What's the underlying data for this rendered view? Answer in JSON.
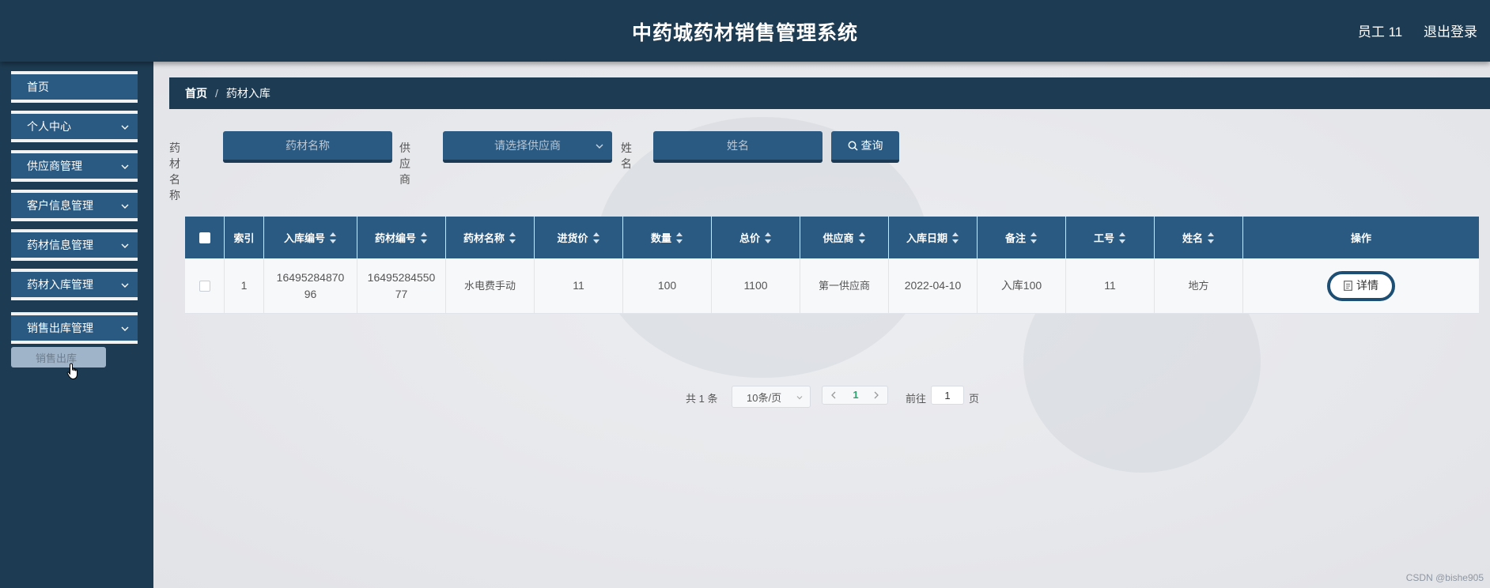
{
  "header": {
    "title": "中药城药材销售管理系统",
    "user": "员工 11",
    "logout": "退出登录"
  },
  "sidebar": {
    "items": [
      {
        "label": "首页"
      },
      {
        "label": "个人中心"
      },
      {
        "label": "供应商管理"
      },
      {
        "label": "客户信息管理"
      },
      {
        "label": "药材信息管理"
      },
      {
        "label": "药材入库管理"
      },
      {
        "label": "销售出库管理"
      }
    ],
    "submenu": {
      "label": "销售出库"
    }
  },
  "breadcrumb": {
    "home": "首页",
    "separator": "/",
    "current": "药材入库"
  },
  "search": {
    "herb_label": "药材名称",
    "herb_placeholder": "药材名称",
    "supplier_label": "供应商",
    "supplier_placeholder": "请选择供应商",
    "name_label": "姓名",
    "name_placeholder": "姓名",
    "query_label": "查询"
  },
  "table": {
    "columns": [
      "索引",
      "入库编号",
      "药材编号",
      "药材名称",
      "进货价",
      "数量",
      "总价",
      "供应商",
      "入库日期",
      "备注",
      "工号",
      "姓名",
      "操作"
    ],
    "rows": [
      {
        "index": "1",
        "stock_no": "1649528487096",
        "herb_no": "1649528455077",
        "herb_name": "水电费手动",
        "price": "11",
        "qty": "100",
        "total": "1100",
        "supplier": "第一供应商",
        "date": "2022-04-10",
        "note": "入库100",
        "emp_no": "11",
        "name": "地方",
        "action": "详情"
      }
    ]
  },
  "pagination": {
    "total_text": "共 1 条",
    "page_size": "10条/页",
    "current_page": "1",
    "goto_label": "前往",
    "goto_value": "1",
    "page_suffix": "页"
  },
  "watermark": "CSDN @bishe905",
  "colors": {
    "header_bg": "#1d3b52",
    "accent": "#2a5a82",
    "current_page": "#2e9e6e"
  }
}
